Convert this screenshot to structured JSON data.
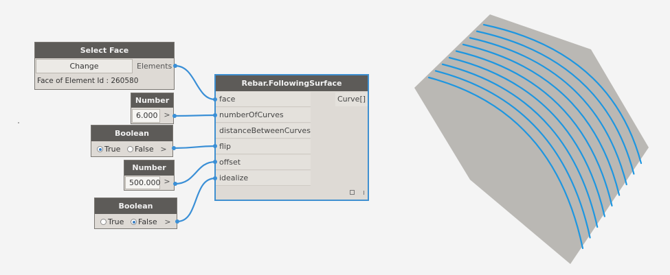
{
  "nodes": {
    "select_face": {
      "title": "Select Face",
      "button_label": "Change",
      "output_label": "Elements",
      "status": "Face of Element Id : 260580"
    },
    "number_1": {
      "title": "Number",
      "value": "6.000",
      "arrow": ">"
    },
    "boolean_1": {
      "title": "Boolean",
      "true_label": "True",
      "false_label": "False",
      "selected": "True",
      "arrow": ">"
    },
    "number_2": {
      "title": "Number",
      "value": "500.000",
      "arrow": ">"
    },
    "boolean_2": {
      "title": "Boolean",
      "true_label": "True",
      "false_label": "False",
      "selected": "False",
      "arrow": ">"
    },
    "rebar": {
      "title": "Rebar.FollowingSurface",
      "inputs": [
        "face",
        "numberOfCurves",
        "distanceBetweenCurves",
        "flip",
        "offset",
        "idealize"
      ],
      "output": "Curve[]"
    }
  },
  "colors": {
    "wire": "#3a8fd6",
    "node_header": "#5d5b58",
    "node_body": "#dedad5",
    "selected_border": "#3e8fd0",
    "surface": "#bab8b4",
    "rebar_curve": "#1e96e0",
    "background": "#f4f4f4"
  }
}
